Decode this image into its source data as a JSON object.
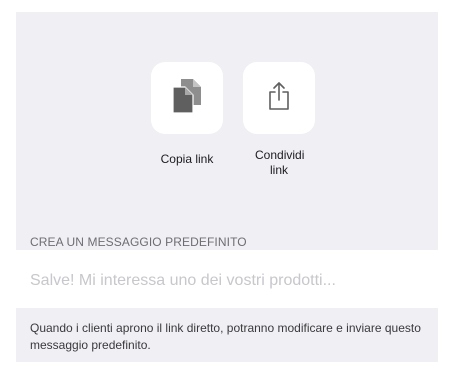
{
  "actions": {
    "copy": {
      "label": "Copia link",
      "icon": "copy-document-icon"
    },
    "share": {
      "label": "Condividi link",
      "icon": "share-icon"
    }
  },
  "predefined_message": {
    "section_title": "CREA UN MESSAGGIO PREDEFINITO",
    "value": "",
    "placeholder": "Salve! Mi interessa uno dei vostri prodotti..."
  },
  "footer": {
    "note": "Quando i clienti aprono il link diretto, potranno modificare e inviare questo messaggio predefinito."
  },
  "colors": {
    "background_gray": "#efeff4",
    "icon_gray": "#6b6b6b",
    "header_text": "#6d6d72",
    "placeholder_text": "#c7c7cc"
  }
}
